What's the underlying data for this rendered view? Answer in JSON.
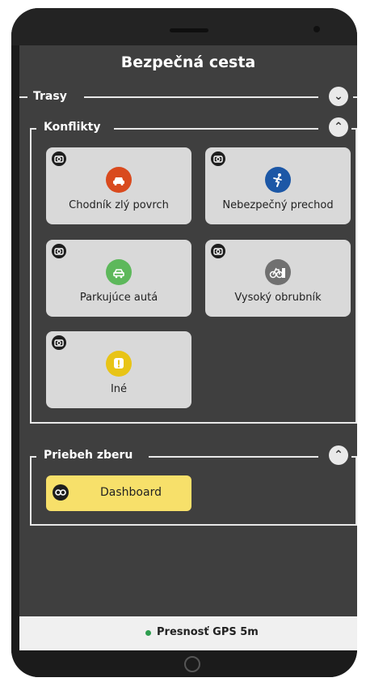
{
  "app": {
    "title": "Bezpečná cesta"
  },
  "sections": {
    "trasy": {
      "title": "Trasy",
      "toggle_icon": "chevron-down-icon",
      "expanded": false
    },
    "konflikty": {
      "title": "Konflikty",
      "toggle_icon": "chevron-up-icon",
      "expanded": true,
      "cards": [
        {
          "label": "Chodník zlý povrch",
          "icon": "car-icon",
          "color": "#d94a1e"
        },
        {
          "label": "Nebezpečný prechod",
          "icon": "pedestrian-icon",
          "color": "#1c57a6"
        },
        {
          "label": "Parkujúce autá",
          "icon": "parking-icon",
          "color": "#5db85b"
        },
        {
          "label": "Vysoký obrubník",
          "icon": "bicycle-icon",
          "color": "#707070"
        },
        {
          "label": "Iné",
          "icon": "alert-icon",
          "color": "#e8c416"
        }
      ]
    },
    "priebeh": {
      "title": "Priebeh zberu",
      "toggle_icon": "chevron-up-icon",
      "expanded": true,
      "button_label": "Dashboard",
      "button_icon": "link-icon",
      "button_color": "#f7e06a"
    }
  },
  "status": {
    "gps_text": "Presnosť GPS 5m",
    "dot_color": "#2e9e4f"
  }
}
